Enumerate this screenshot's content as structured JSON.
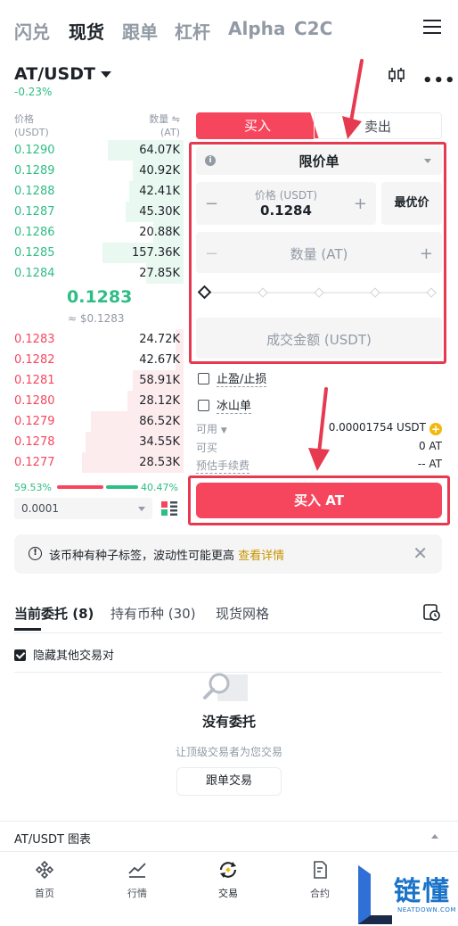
{
  "topnav": {
    "tabs": [
      "闪兑",
      "现货",
      "跟单",
      "杠杆",
      "Alpha",
      "C2C"
    ],
    "active": "现货"
  },
  "pair": {
    "symbol": "AT/USDT",
    "change": "-0.23%"
  },
  "orderbook": {
    "price_header": "价格",
    "price_unit": "(USDT)",
    "qty_header": "数量 ⇋",
    "qty_unit": "(AT)",
    "bids": [
      {
        "price": "0.1290",
        "qty": "64.07K",
        "depth": 0.45
      },
      {
        "price": "0.1289",
        "qty": "40.92K",
        "depth": 0.3
      },
      {
        "price": "0.1288",
        "qty": "42.41K",
        "depth": 0.32
      },
      {
        "price": "0.1287",
        "qty": "45.30K",
        "depth": 0.34
      },
      {
        "price": "0.1286",
        "qty": "20.88K",
        "depth": 0.18
      },
      {
        "price": "0.1285",
        "qty": "157.36K",
        "depth": 0.48
      },
      {
        "price": "0.1284",
        "qty": "27.85K",
        "depth": 0.22
      }
    ],
    "mid_price": "0.1283",
    "mid_fiat": "≈ $0.1283",
    "asks": [
      {
        "price": "0.1283",
        "qty": "24.72K",
        "depth": 0.05
      },
      {
        "price": "0.1282",
        "qty": "42.67K",
        "depth": 0.05
      },
      {
        "price": "0.1281",
        "qty": "58.91K",
        "depth": 0.3
      },
      {
        "price": "0.1280",
        "qty": "28.12K",
        "depth": 0.33
      },
      {
        "price": "0.1279",
        "qty": "86.52K",
        "depth": 0.55
      },
      {
        "price": "0.1278",
        "qty": "34.55K",
        "depth": 0.58
      },
      {
        "price": "0.1277",
        "qty": "28.53K",
        "depth": 0.6
      }
    ],
    "buy_ratio": "59.53%",
    "sell_ratio": "40.47%",
    "depth_precision": "0.0001"
  },
  "trade": {
    "buy_label": "买入",
    "sell_label": "卖出",
    "order_type": "限价单",
    "price_label": "价格 (USDT)",
    "price_value": "0.1284",
    "best_price": "最优价",
    "qty_placeholder": "数量 (AT)",
    "total_placeholder": "成交金额 (USDT)",
    "tpsl": "止盈/止损",
    "iceberg": "冰山单",
    "available_label": "可用",
    "available_value": "0.00001754 USDT",
    "can_buy_label": "可买",
    "can_buy_value": "0 AT",
    "fee_label": "预估手续费",
    "fee_value": "-- AT",
    "submit": "买入 AT"
  },
  "notice": {
    "text": "该币种有种子标签，波动性可能更高",
    "link": "查看详情"
  },
  "orders": {
    "tabs": [
      "当前委托 (8)",
      "持有币种 (30)",
      "现货网格"
    ],
    "hide_others": "隐藏其他交易对",
    "empty_title": "没有委托",
    "empty_sub": "让顶级交易者为您交易",
    "copy_trade": "跟单交易"
  },
  "chart_bar": {
    "title": "AT/USDT 图表"
  },
  "bottom_nav": [
    "首页",
    "行情",
    "交易",
    "合约"
  ],
  "watermark": {
    "text": "链懂",
    "sub": "NEATDOWN.COM"
  },
  "colors": {
    "green": "#2ebd85",
    "red": "#f6465d",
    "annotation": "#e53a4f",
    "gold": "#f0b90b"
  }
}
